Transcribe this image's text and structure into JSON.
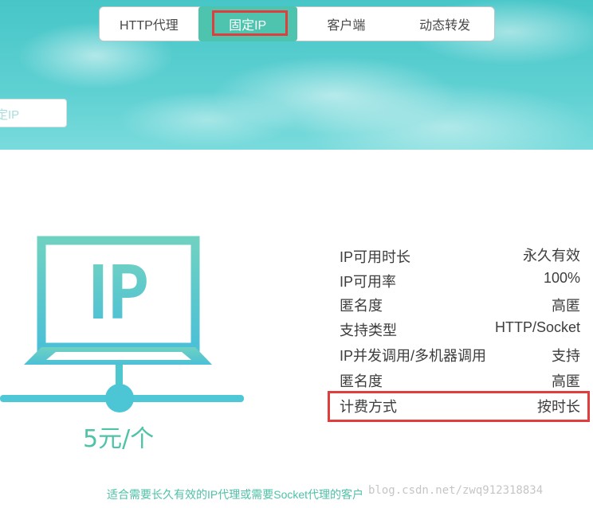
{
  "nav": {
    "items": [
      {
        "label": "HTTP代理"
      },
      {
        "label": "固定IP"
      },
      {
        "label": "客户端"
      },
      {
        "label": "动态转发"
      }
    ],
    "active_index": 1
  },
  "search": {
    "partial_text": "定IP"
  },
  "product": {
    "icon_text": "IP",
    "price": "5元/个"
  },
  "specs": [
    {
      "label": "IP可用时长",
      "value": "永久有效"
    },
    {
      "label": "IP可用率",
      "value": "100%"
    },
    {
      "label": "匿名度",
      "value": "高匿"
    },
    {
      "label": "支持类型",
      "value": "HTTP/Socket"
    },
    {
      "label": "IP并发调用/多机器调用",
      "value": "支持"
    },
    {
      "label": "匿名度",
      "value": "高匿"
    },
    {
      "label": "计费方式",
      "value": "按时长"
    }
  ],
  "footer": {
    "description": "适合需要长久有效的IP代理或需要Socket代理的客户",
    "watermark": "blog.csdn.net/zwq912318834"
  },
  "colors": {
    "accent": "#4ec3ad",
    "sky": "#5ed0d2",
    "highlight": "#e23d3d"
  }
}
